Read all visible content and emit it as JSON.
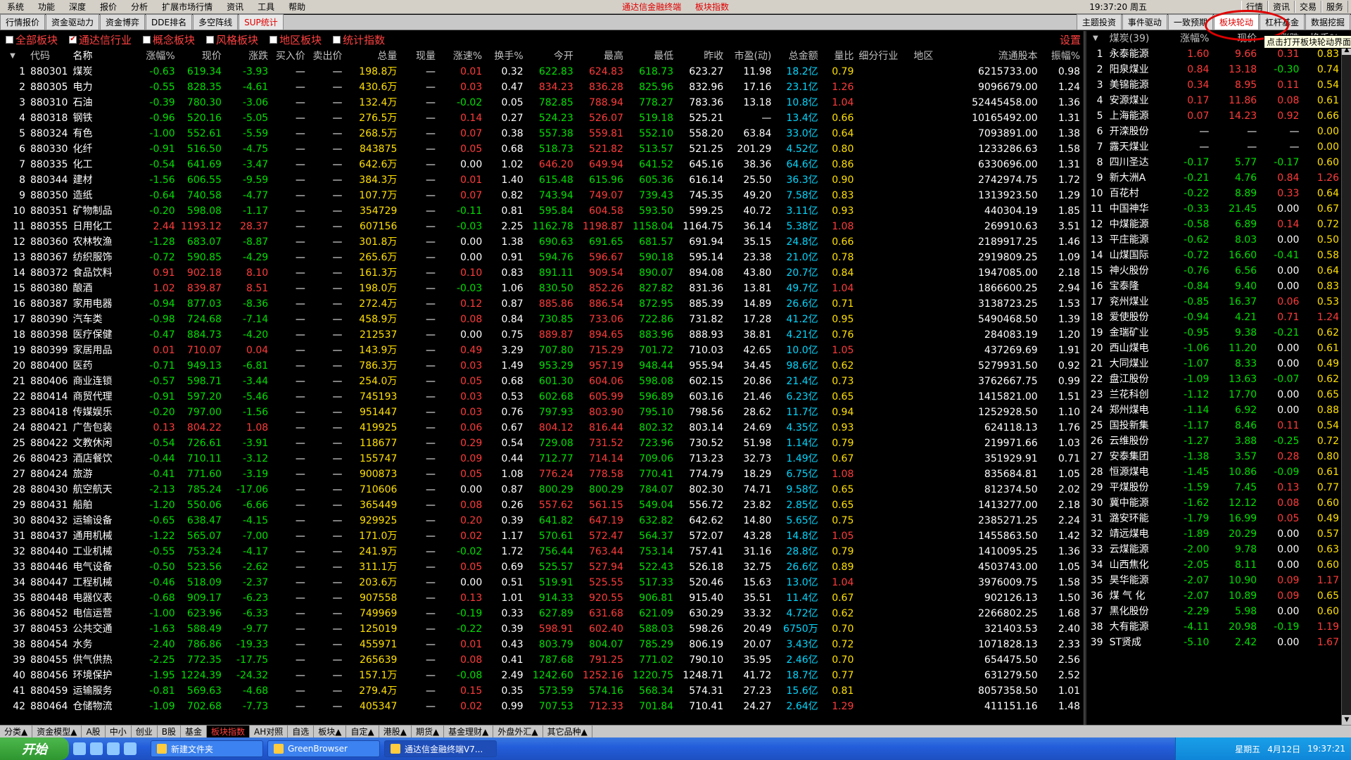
{
  "menu": [
    "系统",
    "功能",
    "深度",
    "报价",
    "分析",
    "扩展市场行情",
    "资讯",
    "工具",
    "帮助"
  ],
  "title_center": [
    "通达信金融终端",
    "板块指数"
  ],
  "clock": "19:37:20 周五",
  "menu_right": [
    "行情",
    "资讯",
    "交易",
    "服务"
  ],
  "tabs_left": [
    "行情报价",
    "资金驱动力",
    "资金博弈",
    "DDE排名",
    "多空阵线",
    "SUP统计"
  ],
  "tabs_right": [
    "主题投资",
    "事件驱动",
    "一致预期",
    "板块轮动",
    "杠杆基金",
    "数据挖掘"
  ],
  "tooltip": "点击打开板块轮动界面",
  "filters": [
    {
      "label": "全部板块",
      "checked": false
    },
    {
      "label": "通达信行业",
      "checked": true
    },
    {
      "label": "概念板块",
      "checked": false
    },
    {
      "label": "风格板块",
      "checked": false
    },
    {
      "label": "地区板块",
      "checked": false
    },
    {
      "label": "统计指数",
      "checked": false
    }
  ],
  "settings_label": "设置",
  "headers": [
    "代码",
    "名称",
    "涨幅%",
    "现价",
    "涨跌",
    "买入价",
    "卖出价",
    "总量",
    "现量",
    "涨速%",
    "换手%",
    "今开",
    "最高",
    "最低",
    "昨收",
    "市盈(动)",
    "总金额",
    "量比",
    "细分行业",
    "地区",
    "流通股本",
    "振幅%"
  ],
  "rows": [
    [
      "1",
      "880301",
      "煤炭",
      "-0.63",
      "619.34",
      "-3.93",
      "—",
      "—",
      "198.8万",
      "—",
      "0.01",
      "0.32",
      "622.83",
      "624.83",
      "618.73",
      "623.27",
      "11.98",
      "18.2亿",
      "0.79",
      "",
      "",
      "6215733.00",
      "0.98"
    ],
    [
      "2",
      "880305",
      "电力",
      "-0.55",
      "828.35",
      "-4.61",
      "—",
      "—",
      "430.6万",
      "—",
      "0.03",
      "0.47",
      "834.23",
      "836.28",
      "825.96",
      "832.96",
      "17.16",
      "23.1亿",
      "1.26",
      "",
      "",
      "9096679.00",
      "1.24"
    ],
    [
      "3",
      "880310",
      "石油",
      "-0.39",
      "780.30",
      "-3.06",
      "—",
      "—",
      "132.4万",
      "—",
      "-0.02",
      "0.05",
      "782.85",
      "788.94",
      "778.27",
      "783.36",
      "13.18",
      "10.8亿",
      "1.04",
      "",
      "",
      "52445458.00",
      "1.36"
    ],
    [
      "4",
      "880318",
      "钢铁",
      "-0.96",
      "520.16",
      "-5.05",
      "—",
      "—",
      "276.5万",
      "—",
      "0.14",
      "0.27",
      "524.23",
      "526.07",
      "519.18",
      "525.21",
      "—",
      "13.4亿",
      "0.66",
      "",
      "",
      "10165492.00",
      "1.31"
    ],
    [
      "5",
      "880324",
      "有色",
      "-1.00",
      "552.61",
      "-5.59",
      "—",
      "—",
      "268.5万",
      "—",
      "0.07",
      "0.38",
      "557.38",
      "559.81",
      "552.10",
      "558.20",
      "63.84",
      "33.0亿",
      "0.64",
      "",
      "",
      "7093891.00",
      "1.38"
    ],
    [
      "6",
      "880330",
      "化纤",
      "-0.91",
      "516.50",
      "-4.75",
      "—",
      "—",
      "843875",
      "—",
      "0.05",
      "0.68",
      "518.73",
      "521.82",
      "513.57",
      "521.25",
      "201.29",
      "4.52亿",
      "0.80",
      "",
      "",
      "1233286.63",
      "1.58"
    ],
    [
      "7",
      "880335",
      "化工",
      "-0.54",
      "641.69",
      "-3.47",
      "—",
      "—",
      "642.6万",
      "—",
      "0.00",
      "1.02",
      "646.20",
      "649.94",
      "641.52",
      "645.16",
      "38.36",
      "64.6亿",
      "0.86",
      "",
      "",
      "6330696.00",
      "1.31"
    ],
    [
      "8",
      "880344",
      "建材",
      "-1.56",
      "606.55",
      "-9.59",
      "—",
      "—",
      "384.3万",
      "—",
      "0.01",
      "1.40",
      "615.48",
      "615.96",
      "605.36",
      "616.14",
      "25.50",
      "36.3亿",
      "0.90",
      "",
      "",
      "2742974.75",
      "1.72"
    ],
    [
      "9",
      "880350",
      "造纸",
      "-0.64",
      "740.58",
      "-4.77",
      "—",
      "—",
      "107.7万",
      "—",
      "0.07",
      "0.82",
      "743.94",
      "749.07",
      "739.43",
      "745.35",
      "49.20",
      "7.58亿",
      "0.83",
      "",
      "",
      "1313923.50",
      "1.29"
    ],
    [
      "10",
      "880351",
      "矿物制品",
      "-0.20",
      "598.08",
      "-1.17",
      "—",
      "—",
      "354729",
      "—",
      "-0.11",
      "0.81",
      "595.84",
      "604.58",
      "593.50",
      "599.25",
      "40.72",
      "3.11亿",
      "0.93",
      "",
      "",
      "440304.19",
      "1.85"
    ],
    [
      "11",
      "880355",
      "日用化工",
      "2.44",
      "1193.12",
      "28.37",
      "—",
      "—",
      "607156",
      "—",
      "-0.03",
      "2.25",
      "1162.78",
      "1198.87",
      "1158.04",
      "1164.75",
      "36.14",
      "5.38亿",
      "1.08",
      "",
      "",
      "269910.63",
      "3.51"
    ],
    [
      "12",
      "880360",
      "农林牧渔",
      "-1.28",
      "683.07",
      "-8.87",
      "—",
      "—",
      "301.8万",
      "—",
      "0.00",
      "1.38",
      "690.63",
      "691.65",
      "681.57",
      "691.94",
      "35.15",
      "24.8亿",
      "0.66",
      "",
      "",
      "2189917.25",
      "1.46"
    ],
    [
      "13",
      "880367",
      "纺织服饰",
      "-0.72",
      "590.85",
      "-4.29",
      "—",
      "—",
      "265.6万",
      "—",
      "0.00",
      "0.91",
      "594.76",
      "596.67",
      "590.18",
      "595.14",
      "23.38",
      "21.0亿",
      "0.78",
      "",
      "",
      "2919809.25",
      "1.09"
    ],
    [
      "14",
      "880372",
      "食品饮料",
      "0.91",
      "902.18",
      "8.10",
      "—",
      "—",
      "161.3万",
      "—",
      "0.10",
      "0.83",
      "891.11",
      "909.54",
      "890.07",
      "894.08",
      "43.80",
      "20.7亿",
      "0.84",
      "",
      "",
      "1947085.00",
      "2.18"
    ],
    [
      "15",
      "880380",
      "酿酒",
      "1.02",
      "839.87",
      "8.51",
      "—",
      "—",
      "198.0万",
      "—",
      "-0.03",
      "1.06",
      "830.50",
      "852.26",
      "827.82",
      "831.36",
      "13.81",
      "49.7亿",
      "1.04",
      "",
      "",
      "1866600.25",
      "2.94"
    ],
    [
      "16",
      "880387",
      "家用电器",
      "-0.94",
      "877.03",
      "-8.36",
      "—",
      "—",
      "272.4万",
      "—",
      "0.12",
      "0.87",
      "885.86",
      "886.54",
      "872.95",
      "885.39",
      "14.89",
      "26.6亿",
      "0.71",
      "",
      "",
      "3138723.25",
      "1.53"
    ],
    [
      "17",
      "880390",
      "汽车类",
      "-0.98",
      "724.68",
      "-7.14",
      "—",
      "—",
      "458.9万",
      "—",
      "0.08",
      "0.84",
      "730.85",
      "733.06",
      "722.86",
      "731.82",
      "17.28",
      "41.2亿",
      "0.95",
      "",
      "",
      "5490468.50",
      "1.39"
    ],
    [
      "18",
      "880398",
      "医疗保健",
      "-0.47",
      "884.73",
      "-4.20",
      "—",
      "—",
      "212537",
      "—",
      "0.00",
      "0.75",
      "889.87",
      "894.65",
      "883.96",
      "888.93",
      "38.81",
      "4.21亿",
      "0.76",
      "",
      "",
      "284083.19",
      "1.20"
    ],
    [
      "19",
      "880399",
      "家居用品",
      "0.01",
      "710.07",
      "0.04",
      "—",
      "—",
      "143.9万",
      "—",
      "0.49",
      "3.29",
      "707.80",
      "715.29",
      "701.72",
      "710.03",
      "42.65",
      "10.0亿",
      "1.05",
      "",
      "",
      "437269.69",
      "1.91"
    ],
    [
      "20",
      "880400",
      "医药",
      "-0.71",
      "949.13",
      "-6.81",
      "—",
      "—",
      "786.3万",
      "—",
      "0.03",
      "1.49",
      "953.29",
      "957.19",
      "948.44",
      "955.94",
      "34.45",
      "98.6亿",
      "0.62",
      "",
      "",
      "5279931.50",
      "0.92"
    ],
    [
      "21",
      "880406",
      "商业连锁",
      "-0.57",
      "598.71",
      "-3.44",
      "—",
      "—",
      "254.0万",
      "—",
      "0.05",
      "0.68",
      "601.30",
      "604.06",
      "598.08",
      "602.15",
      "20.86",
      "21.4亿",
      "0.73",
      "",
      "",
      "3762667.75",
      "0.99"
    ],
    [
      "22",
      "880414",
      "商贸代理",
      "-0.91",
      "597.20",
      "-5.46",
      "—",
      "—",
      "745193",
      "—",
      "0.03",
      "0.53",
      "602.68",
      "605.99",
      "596.89",
      "603.16",
      "21.46",
      "6.23亿",
      "0.65",
      "",
      "",
      "1415821.00",
      "1.51"
    ],
    [
      "23",
      "880418",
      "传媒娱乐",
      "-0.20",
      "797.00",
      "-1.56",
      "—",
      "—",
      "951447",
      "—",
      "0.03",
      "0.76",
      "797.93",
      "803.90",
      "795.10",
      "798.56",
      "28.62",
      "11.7亿",
      "0.94",
      "",
      "",
      "1252928.50",
      "1.10"
    ],
    [
      "24",
      "880421",
      "广告包装",
      "0.13",
      "804.22",
      "1.08",
      "—",
      "—",
      "419925",
      "—",
      "0.06",
      "0.67",
      "804.12",
      "816.44",
      "802.32",
      "803.14",
      "24.69",
      "4.35亿",
      "0.93",
      "",
      "",
      "624118.13",
      "1.76"
    ],
    [
      "25",
      "880422",
      "文教休闲",
      "-0.54",
      "726.61",
      "-3.91",
      "—",
      "—",
      "118677",
      "—",
      "0.29",
      "0.54",
      "729.08",
      "731.52",
      "723.96",
      "730.52",
      "51.98",
      "1.14亿",
      "0.79",
      "",
      "",
      "219971.66",
      "1.03"
    ],
    [
      "26",
      "880423",
      "酒店餐饮",
      "-0.44",
      "710.11",
      "-3.12",
      "—",
      "—",
      "155747",
      "—",
      "0.09",
      "0.44",
      "712.77",
      "714.14",
      "709.06",
      "713.23",
      "32.73",
      "1.49亿",
      "0.67",
      "",
      "",
      "351929.91",
      "0.71"
    ],
    [
      "27",
      "880424",
      "旅游",
      "-0.41",
      "771.60",
      "-3.19",
      "—",
      "—",
      "900873",
      "—",
      "0.05",
      "1.08",
      "776.24",
      "778.58",
      "770.41",
      "774.79",
      "18.29",
      "6.75亿",
      "1.08",
      "",
      "",
      "835684.81",
      "1.05"
    ],
    [
      "28",
      "880430",
      "航空航天",
      "-2.13",
      "785.24",
      "-17.06",
      "—",
      "—",
      "710606",
      "—",
      "0.00",
      "0.87",
      "800.29",
      "800.29",
      "784.07",
      "802.30",
      "74.71",
      "9.58亿",
      "0.65",
      "",
      "",
      "812374.50",
      "2.02"
    ],
    [
      "29",
      "880431",
      "船舶",
      "-1.20",
      "550.06",
      "-6.66",
      "—",
      "—",
      "365449",
      "—",
      "0.08",
      "0.26",
      "557.62",
      "561.15",
      "549.04",
      "556.72",
      "23.82",
      "2.85亿",
      "0.65",
      "",
      "",
      "1413277.00",
      "2.18"
    ],
    [
      "30",
      "880432",
      "运输设备",
      "-0.65",
      "638.47",
      "-4.15",
      "—",
      "—",
      "929925",
      "—",
      "0.20",
      "0.39",
      "641.82",
      "647.19",
      "632.82",
      "642.62",
      "14.80",
      "5.65亿",
      "0.75",
      "",
      "",
      "2385271.25",
      "2.24"
    ],
    [
      "31",
      "880437",
      "通用机械",
      "-1.22",
      "565.07",
      "-7.00",
      "—",
      "—",
      "171.0万",
      "—",
      "0.02",
      "1.17",
      "570.61",
      "572.47",
      "564.37",
      "572.07",
      "43.28",
      "14.8亿",
      "1.05",
      "",
      "",
      "1455863.50",
      "1.42"
    ],
    [
      "32",
      "880440",
      "工业机械",
      "-0.55",
      "753.24",
      "-4.17",
      "—",
      "—",
      "241.9万",
      "—",
      "-0.02",
      "1.72",
      "756.44",
      "763.44",
      "753.14",
      "757.41",
      "31.16",
      "28.8亿",
      "0.79",
      "",
      "",
      "1410095.25",
      "1.36"
    ],
    [
      "33",
      "880446",
      "电气设备",
      "-0.50",
      "523.56",
      "-2.62",
      "—",
      "—",
      "311.1万",
      "—",
      "0.05",
      "0.69",
      "525.57",
      "527.94",
      "522.43",
      "526.18",
      "32.75",
      "26.6亿",
      "0.89",
      "",
      "",
      "4503743.00",
      "1.05"
    ],
    [
      "34",
      "880447",
      "工程机械",
      "-0.46",
      "518.09",
      "-2.37",
      "—",
      "—",
      "203.6万",
      "—",
      "0.00",
      "0.51",
      "519.91",
      "525.55",
      "517.33",
      "520.46",
      "15.63",
      "13.0亿",
      "1.04",
      "",
      "",
      "3976009.75",
      "1.58"
    ],
    [
      "35",
      "880448",
      "电器仪表",
      "-0.68",
      "909.17",
      "-6.23",
      "—",
      "—",
      "907558",
      "—",
      "0.13",
      "1.01",
      "914.33",
      "920.55",
      "906.81",
      "915.40",
      "35.51",
      "11.4亿",
      "0.67",
      "",
      "",
      "902126.13",
      "1.50"
    ],
    [
      "36",
      "880452",
      "电信运营",
      "-1.00",
      "623.96",
      "-6.33",
      "—",
      "—",
      "749969",
      "—",
      "-0.19",
      "0.33",
      "627.89",
      "631.68",
      "621.09",
      "630.29",
      "33.32",
      "4.72亿",
      "0.62",
      "",
      "",
      "2266802.25",
      "1.68"
    ],
    [
      "37",
      "880453",
      "公共交通",
      "-1.63",
      "588.49",
      "-9.77",
      "—",
      "—",
      "125019",
      "—",
      "-0.22",
      "0.39",
      "598.91",
      "602.40",
      "588.03",
      "598.26",
      "20.49",
      "6750万",
      "0.70",
      "",
      "",
      "321403.53",
      "2.40"
    ],
    [
      "38",
      "880454",
      "水务",
      "-2.40",
      "786.86",
      "-19.33",
      "—",
      "—",
      "455971",
      "—",
      "0.01",
      "0.43",
      "803.79",
      "804.07",
      "785.29",
      "806.19",
      "20.07",
      "3.43亿",
      "0.72",
      "",
      "",
      "1071828.13",
      "2.33"
    ],
    [
      "39",
      "880455",
      "供气供热",
      "-2.25",
      "772.35",
      "-17.75",
      "—",
      "—",
      "265639",
      "—",
      "0.08",
      "0.41",
      "787.68",
      "791.25",
      "771.02",
      "790.10",
      "35.95",
      "2.46亿",
      "0.70",
      "",
      "",
      "654475.50",
      "2.56"
    ],
    [
      "40",
      "880456",
      "环境保护",
      "-1.95",
      "1224.39",
      "-24.32",
      "—",
      "—",
      "157.1万",
      "—",
      "-0.08",
      "2.49",
      "1242.60",
      "1252.16",
      "1220.75",
      "1248.71",
      "41.72",
      "18.7亿",
      "0.77",
      "",
      "",
      "631279.50",
      "2.52"
    ],
    [
      "41",
      "880459",
      "运输服务",
      "-0.81",
      "569.63",
      "-4.68",
      "—",
      "—",
      "279.4万",
      "—",
      "0.15",
      "0.35",
      "573.59",
      "574.16",
      "568.34",
      "574.31",
      "27.23",
      "15.6亿",
      "0.81",
      "",
      "",
      "8057358.50",
      "1.01"
    ],
    [
      "42",
      "880464",
      "仓储物流",
      "-1.09",
      "702.68",
      "-7.73",
      "—",
      "—",
      "405347",
      "—",
      "0.02",
      "0.99",
      "707.53",
      "712.33",
      "701.84",
      "710.41",
      "24.27",
      "2.64亿",
      "1.29",
      "",
      "",
      "411151.16",
      "1.48"
    ]
  ],
  "side_headers": [
    "煤炭(39)",
    "涨幅%",
    "现价",
    "涨跌",
    "换手%"
  ],
  "side_rows": [
    [
      "1",
      "永泰能源",
      "1.60",
      "9.66",
      "0.31",
      "0.83"
    ],
    [
      "2",
      "阳泉煤业",
      "0.84",
      "13.18",
      "-0.30",
      "0.74"
    ],
    [
      "3",
      "美锦能源",
      "0.34",
      "8.95",
      "0.11",
      "0.54"
    ],
    [
      "4",
      "安源煤业",
      "0.17",
      "11.86",
      "0.08",
      "0.61"
    ],
    [
      "5",
      "上海能源",
      "0.07",
      "14.23",
      "0.92",
      "0.66"
    ],
    [
      "6",
      "开滦股份",
      "—",
      "—",
      "—",
      "0.00"
    ],
    [
      "7",
      "露天煤业",
      "—",
      "—",
      "—",
      "0.00"
    ],
    [
      "8",
      "四川圣达",
      "-0.17",
      "5.77",
      "-0.17",
      "0.60"
    ],
    [
      "9",
      "新大洲A",
      "-0.21",
      "4.76",
      "0.84",
      "1.26"
    ],
    [
      "10",
      "百花村",
      "-0.22",
      "8.89",
      "0.33",
      "0.64"
    ],
    [
      "11",
      "中国神华",
      "-0.33",
      "21.45",
      "0.00",
      "0.67"
    ],
    [
      "12",
      "中煤能源",
      "-0.58",
      "6.89",
      "0.14",
      "0.72"
    ],
    [
      "13",
      "平庄能源",
      "-0.62",
      "8.03",
      "0.00",
      "0.50"
    ],
    [
      "14",
      "山煤国际",
      "-0.72",
      "16.60",
      "-0.41",
      "0.58"
    ],
    [
      "15",
      "神火股份",
      "-0.76",
      "6.56",
      "0.00",
      "0.64"
    ],
    [
      "16",
      "宝泰隆",
      "-0.84",
      "9.40",
      "0.00",
      "0.83"
    ],
    [
      "17",
      "兖州煤业",
      "-0.85",
      "16.37",
      "0.06",
      "0.53"
    ],
    [
      "18",
      "爱使股份",
      "-0.94",
      "4.21",
      "0.71",
      "1.24"
    ],
    [
      "19",
      "金瑞矿业",
      "-0.95",
      "9.38",
      "-0.21",
      "0.62"
    ],
    [
      "20",
      "西山煤电",
      "-1.06",
      "11.20",
      "0.00",
      "0.61"
    ],
    [
      "21",
      "大同煤业",
      "-1.07",
      "8.33",
      "0.00",
      "0.49"
    ],
    [
      "22",
      "盘江股份",
      "-1.09",
      "13.63",
      "-0.07",
      "0.62"
    ],
    [
      "23",
      "兰花科创",
      "-1.12",
      "17.70",
      "0.00",
      "0.65"
    ],
    [
      "24",
      "郑州煤电",
      "-1.14",
      "6.92",
      "0.00",
      "0.88"
    ],
    [
      "25",
      "国投新集",
      "-1.17",
      "8.46",
      "0.11",
      "0.54"
    ],
    [
      "26",
      "云维股份",
      "-1.27",
      "3.88",
      "-0.25",
      "0.72"
    ],
    [
      "27",
      "安泰集团",
      "-1.38",
      "3.57",
      "0.28",
      "0.80"
    ],
    [
      "28",
      "恒源煤电",
      "-1.45",
      "10.86",
      "-0.09",
      "0.61"
    ],
    [
      "29",
      "平煤股份",
      "-1.59",
      "7.45",
      "0.13",
      "0.77"
    ],
    [
      "30",
      "冀中能源",
      "-1.62",
      "12.12",
      "0.08",
      "0.60"
    ],
    [
      "31",
      "潞安环能",
      "-1.79",
      "16.99",
      "0.05",
      "0.49"
    ],
    [
      "32",
      "靖远煤电",
      "-1.89",
      "20.29",
      "0.00",
      "0.57"
    ],
    [
      "33",
      "云煤能源",
      "-2.00",
      "9.78",
      "0.00",
      "0.63"
    ],
    [
      "34",
      "山西焦化",
      "-2.05",
      "8.11",
      "0.00",
      "0.60"
    ],
    [
      "35",
      "昊华能源",
      "-2.07",
      "10.90",
      "0.09",
      "1.17"
    ],
    [
      "36",
      "煤 气 化",
      "-2.07",
      "10.89",
      "0.09",
      "0.65"
    ],
    [
      "37",
      "黑化股份",
      "-2.29",
      "5.98",
      "0.00",
      "0.60"
    ],
    [
      "38",
      "大有能源",
      "-4.11",
      "20.98",
      "-0.19",
      "1.19"
    ],
    [
      "39",
      "ST贤成",
      "-5.10",
      "2.42",
      "0.00",
      "1.67"
    ]
  ],
  "bottom_tabs": [
    "分类▲",
    "资金模型▲",
    "A股",
    "中小",
    "创业",
    "B股",
    "基金",
    "板块指数",
    "AH对照",
    "自选",
    "板块▲",
    "自定▲",
    "港股▲",
    "期货▲",
    "基金理财▲",
    "外盘外汇▲",
    "其它品种▲"
  ],
  "bottom_active": "板块指数",
  "taskbar": {
    "start": "开始",
    "tasks": [
      "新建文件夹",
      "GreenBrowser",
      "通达信金融终端V7..."
    ],
    "tray_day": "星期五",
    "tray_date": "4月12日",
    "tray_time": "19:37:21"
  },
  "colors": {
    "up": "#ff3b3b",
    "down": "#00e000",
    "bg": "#000000",
    "accent": "#e00000"
  }
}
